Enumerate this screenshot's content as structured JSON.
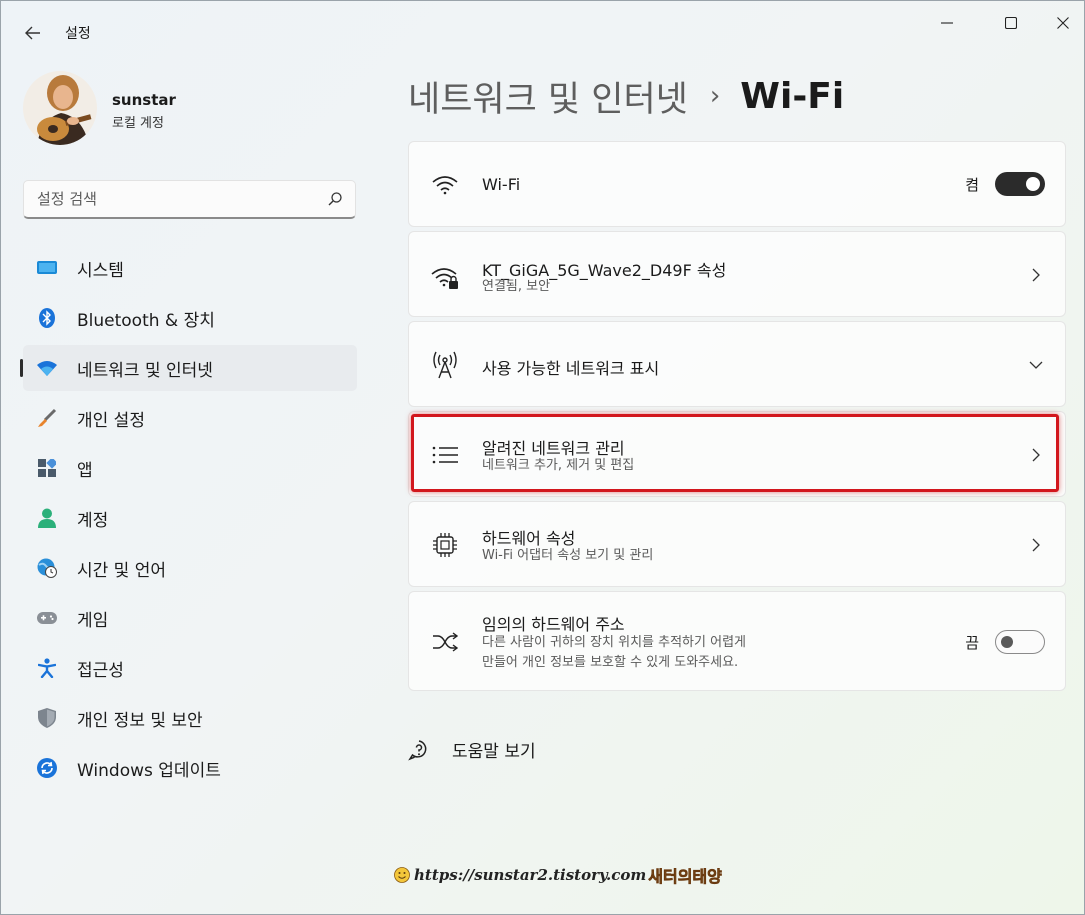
{
  "app": {
    "title": "설정"
  },
  "user": {
    "name": "sunstar",
    "account_type": "로컬 계정"
  },
  "search": {
    "placeholder": "설정 검색"
  },
  "sidebar": {
    "items": [
      {
        "label": "시스템",
        "icon": "system-icon"
      },
      {
        "label": "Bluetooth & 장치",
        "icon": "bluetooth-icon"
      },
      {
        "label": "네트워크 및 인터넷",
        "icon": "wifi-icon",
        "selected": true
      },
      {
        "label": "개인 설정",
        "icon": "brush-icon"
      },
      {
        "label": "앱",
        "icon": "apps-icon"
      },
      {
        "label": "계정",
        "icon": "person-icon"
      },
      {
        "label": "시간 및 언어",
        "icon": "globe-clock-icon"
      },
      {
        "label": "게임",
        "icon": "gamepad-icon"
      },
      {
        "label": "접근성",
        "icon": "accessibility-icon"
      },
      {
        "label": "개인 정보 및 보안",
        "icon": "shield-icon"
      },
      {
        "label": "Windows 업데이트",
        "icon": "update-icon"
      }
    ]
  },
  "breadcrumb": {
    "parent": "네트워크 및 인터넷",
    "separator": "›",
    "current": "Wi-Fi"
  },
  "cards": {
    "wifi": {
      "title": "Wi-Fi",
      "toggle_label": "켬",
      "toggle_on": true
    },
    "network": {
      "title": "KT_GiGA_5G_Wave2_D49F 속성",
      "subtitle": "연결됨, 보안"
    },
    "available": {
      "title": "사용 가능한 네트워크 표시"
    },
    "known": {
      "title": "알려진 네트워크 관리",
      "subtitle": "네트워크 추가, 제거 및 편집",
      "highlighted": true
    },
    "hardware": {
      "title": "하드웨어 속성",
      "subtitle": "Wi-Fi 어댑터 속성 보기 및 관리"
    },
    "random": {
      "title": "임의의 하드웨어 주소",
      "subtitle_line1": "다른 사람이 귀하의 장치 위치를 추적하기 어렵게",
      "subtitle_line2": "만들어 개인 정보를 보호할 수 있게 도와주세요.",
      "toggle_label": "끔",
      "toggle_on": false
    }
  },
  "help": {
    "label": "도움말 보기"
  },
  "watermark": {
    "url": "https://sunstar2.tistory.com",
    "name": "새터의태양"
  },
  "colors": {
    "accent": "#0067c0",
    "highlight_border": "#d2171d",
    "toggle_on": "#2b2b2b"
  }
}
